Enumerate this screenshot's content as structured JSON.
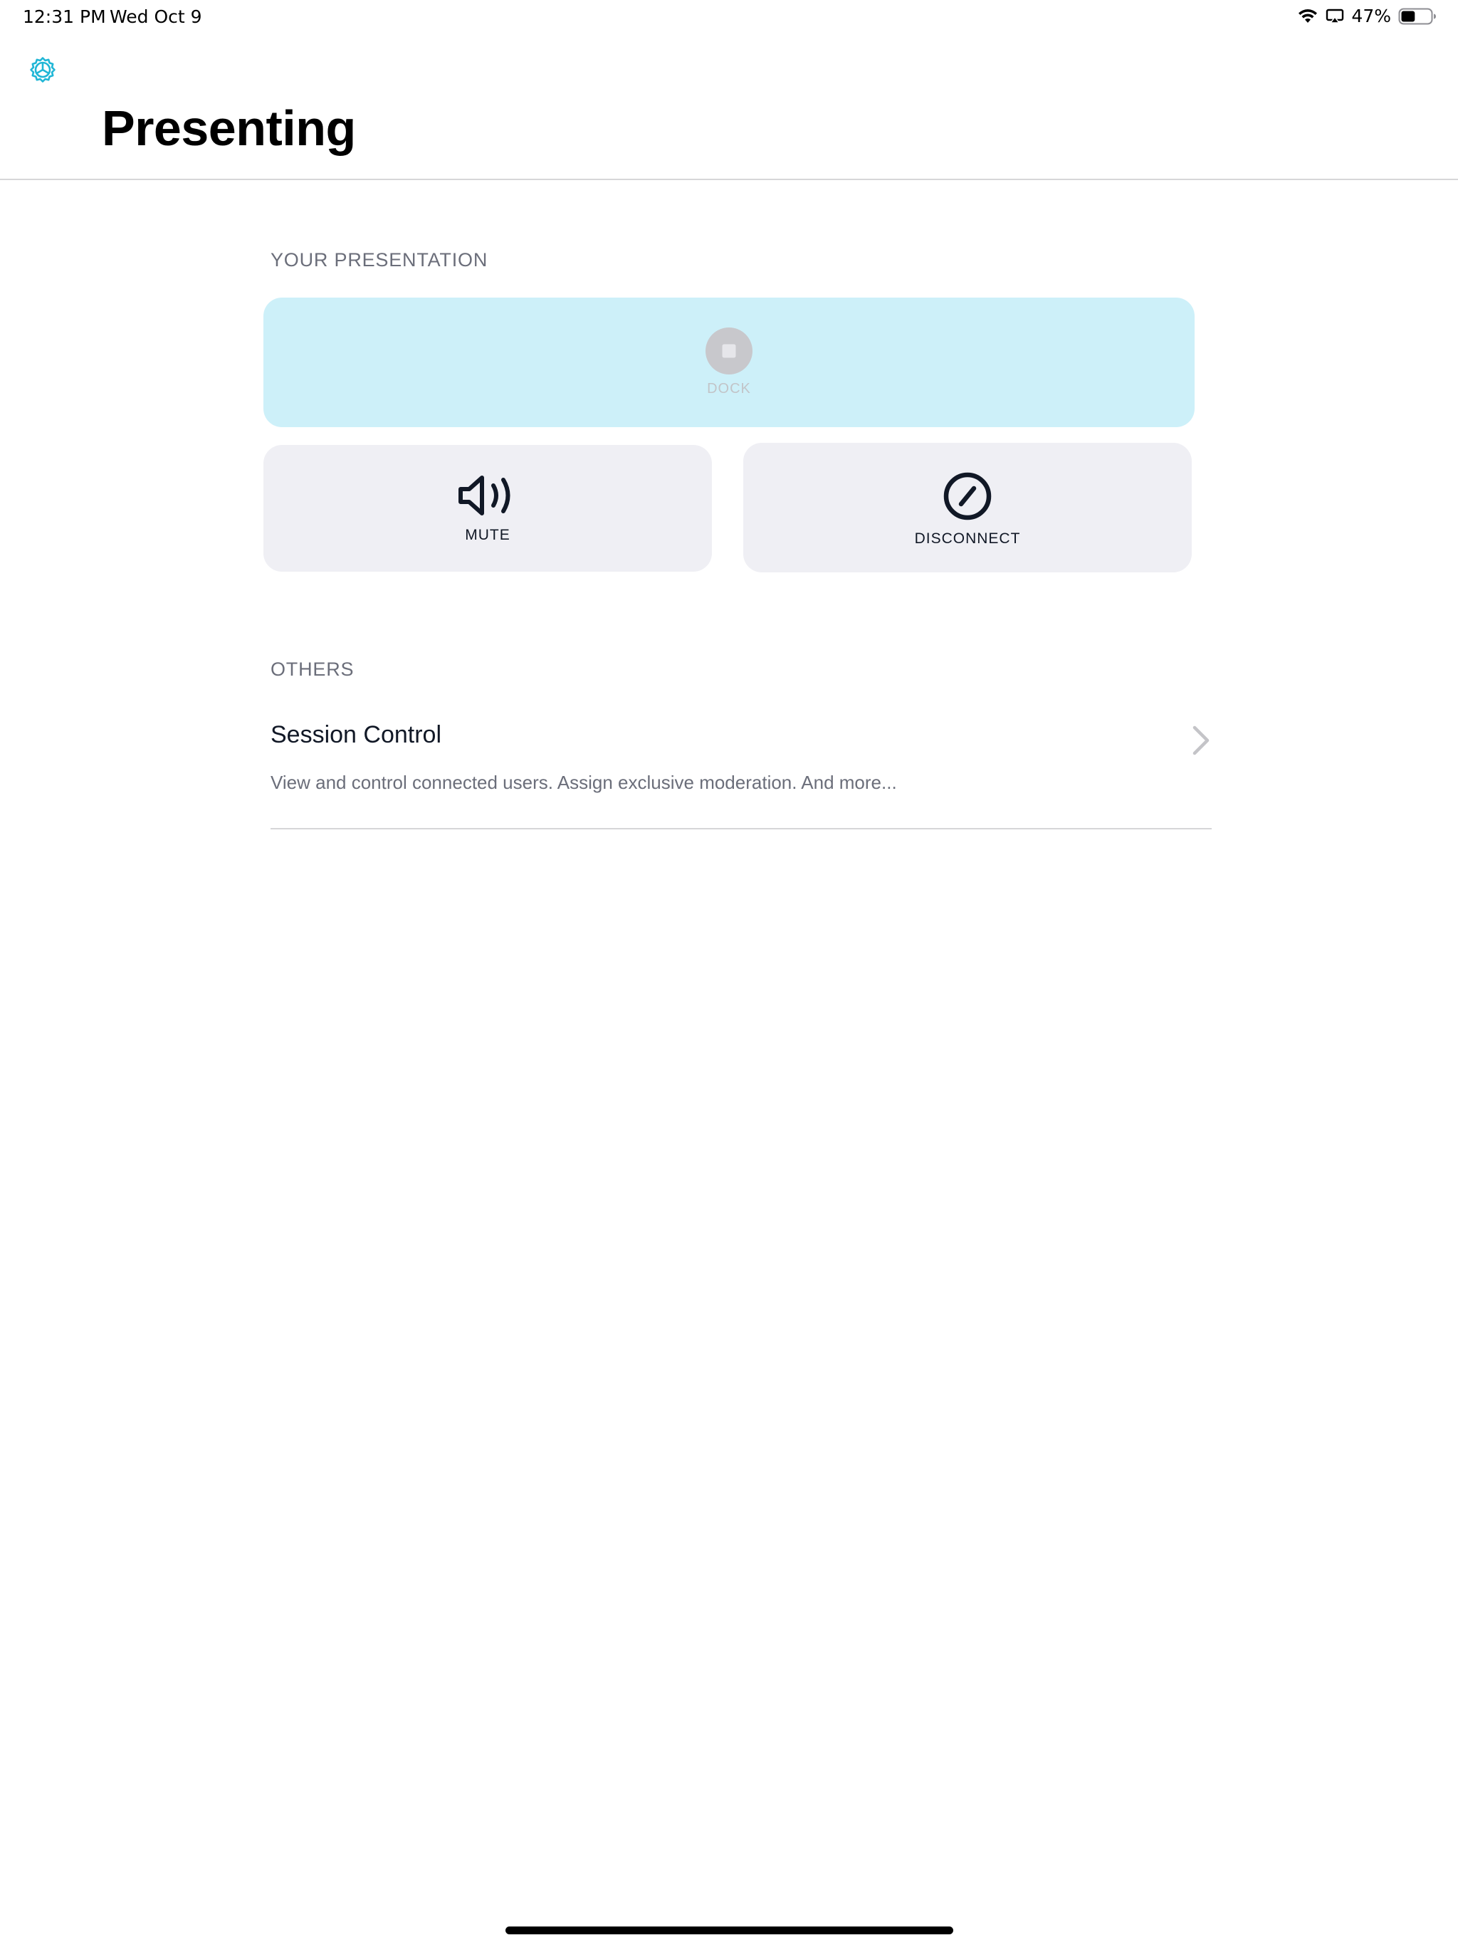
{
  "status_bar": {
    "time": "12:31 PM",
    "date": "Wed Oct 9",
    "battery_percent": "47%",
    "battery_level": 0.47,
    "icons": [
      "wifi-icon",
      "airplay-icon",
      "battery-icon"
    ]
  },
  "header": {
    "title": "Presenting",
    "settings_icon": "gear-icon"
  },
  "presentation": {
    "section_label": "YOUR PRESENTATION",
    "dock": {
      "label": "DOCK",
      "icon": "stop-circle-icon",
      "enabled": false
    },
    "mute": {
      "label": "MUTE",
      "icon": "speaker-wave-icon"
    },
    "disconnect": {
      "label": "DISCONNECT",
      "icon": "prohibit-icon"
    }
  },
  "others": {
    "section_label": "OTHERS",
    "items": [
      {
        "title": "Session Control",
        "subtitle": "View and control connected users. Assign exclusive moderation. And more...",
        "icon": "chevron-right-icon"
      }
    ]
  },
  "colors": {
    "accent": "#1fb6d6",
    "dock_bg": "#cdf0f9",
    "card_bg": "#efeff4",
    "label_gray": "#6b6e7a",
    "text_dark": "#111826"
  }
}
